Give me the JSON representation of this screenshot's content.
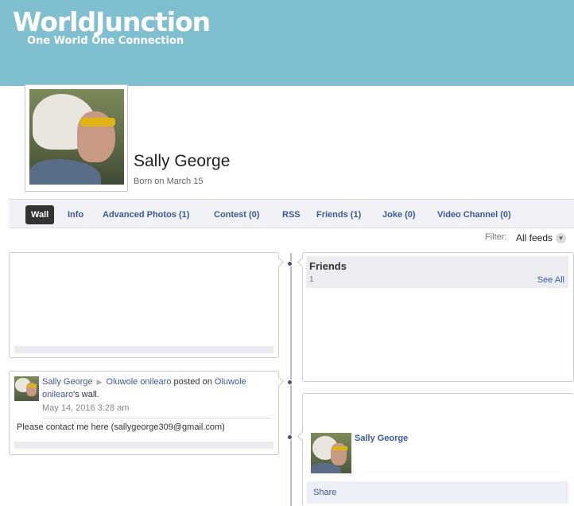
{
  "brand": {
    "logo": "WorldJunction",
    "tagline": "One World One Connection"
  },
  "profile": {
    "name": "Sally George",
    "born": "Born on March 15"
  },
  "tabs": [
    {
      "label": "Wall",
      "active": true
    },
    {
      "label": "Info"
    },
    {
      "label": "Advanced Photos (1)"
    },
    {
      "label": "Contest (0)"
    },
    {
      "label": "RSS"
    },
    {
      "label": "Friends (1)"
    },
    {
      "label": "Joke (0)"
    },
    {
      "label": "Video Channel (0)"
    }
  ],
  "filter": {
    "label": "Filter:",
    "value": "All feeds"
  },
  "post": {
    "author": "Sally George",
    "target": "Oluwole onilearo",
    "action": "posted on",
    "wall_owner_a": "Oluwole",
    "wall_owner_b": "onilearo",
    "wall_suffix": "'s wall.",
    "date": "May 14, 2016 3:28 am",
    "body": "Please contact me here (sallygeorge309@gmail.com)"
  },
  "friends": {
    "title": "Friends",
    "count": "1",
    "see_all": "See All",
    "items": [
      {
        "name": "Sally George"
      }
    ]
  },
  "share": {
    "label": "Share"
  },
  "colors": {
    "header_bg": "#7fbfcf",
    "link": "#3b5998",
    "active_tab_bg": "#333333"
  }
}
